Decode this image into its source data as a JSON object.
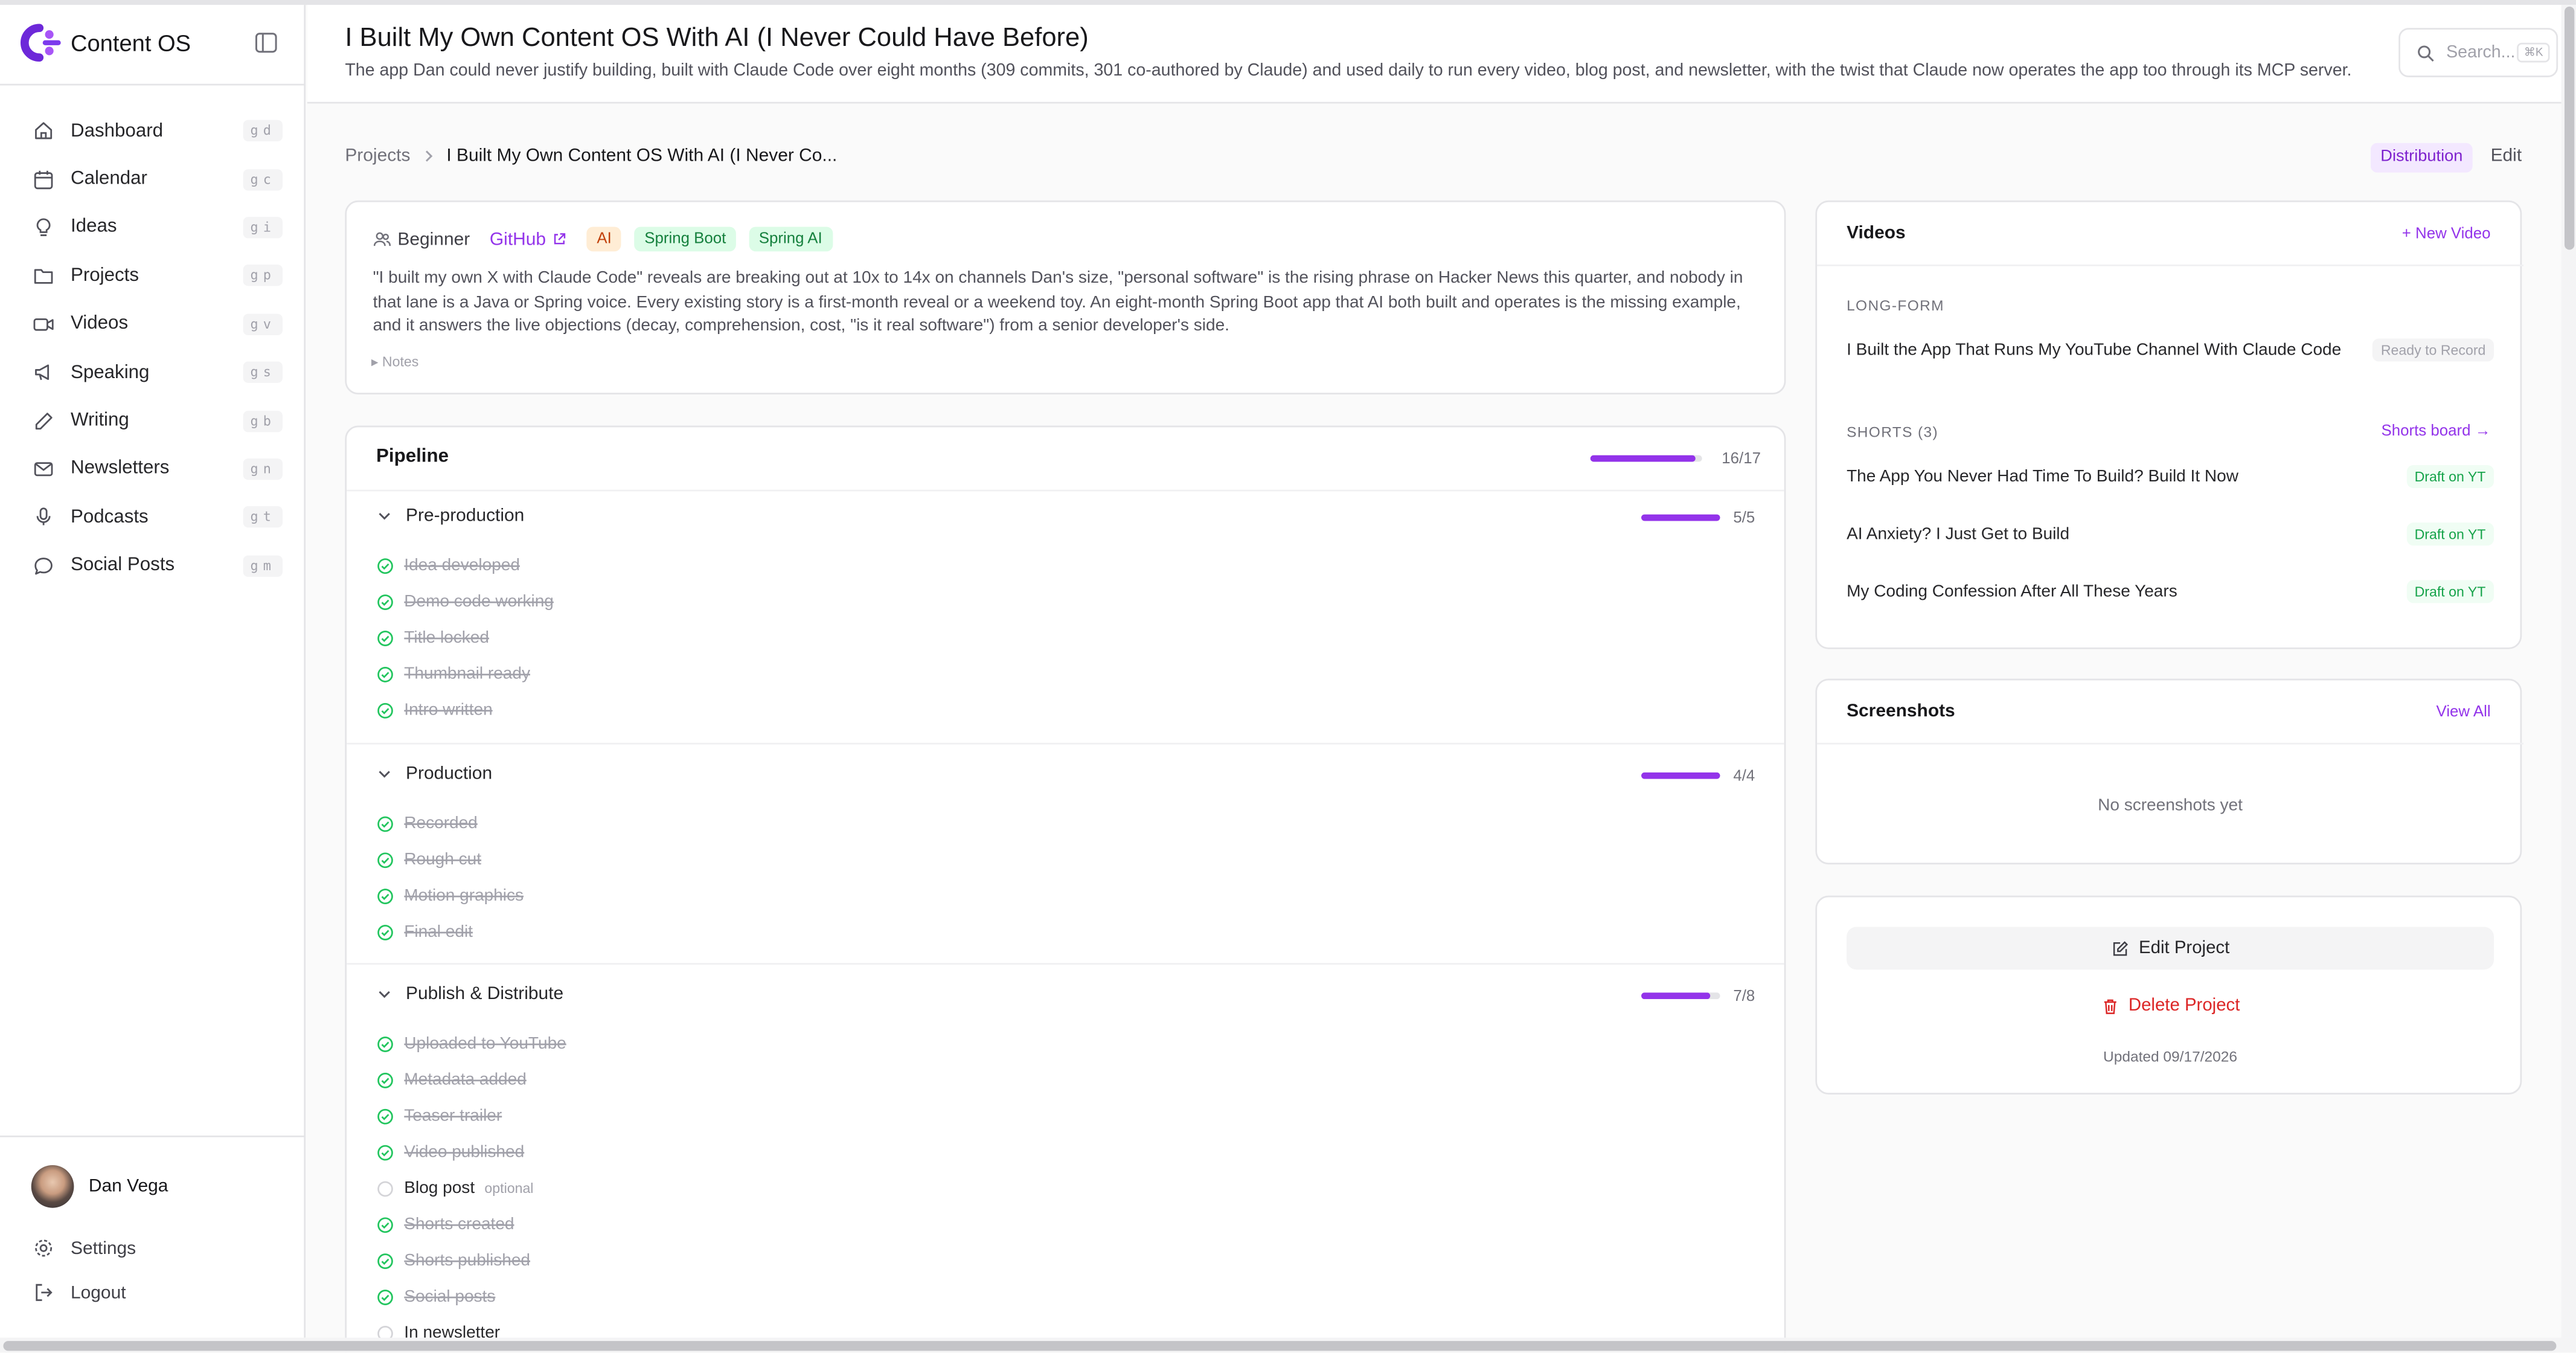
{
  "app": {
    "name": "Content OS"
  },
  "sidebar": {
    "items": [
      {
        "label": "Dashboard",
        "shortcut": "gd",
        "icon": "home-icon"
      },
      {
        "label": "Calendar",
        "shortcut": "gc",
        "icon": "calendar-icon"
      },
      {
        "label": "Ideas",
        "shortcut": "gi",
        "icon": "lightbulb-icon"
      },
      {
        "label": "Projects",
        "shortcut": "gp",
        "icon": "folder-icon"
      },
      {
        "label": "Videos",
        "shortcut": "gv",
        "icon": "video-icon"
      },
      {
        "label": "Speaking",
        "shortcut": "gs",
        "icon": "megaphone-icon"
      },
      {
        "label": "Writing",
        "shortcut": "gb",
        "icon": "pen-icon"
      },
      {
        "label": "Newsletters",
        "shortcut": "gn",
        "icon": "mail-icon"
      },
      {
        "label": "Podcasts",
        "shortcut": "gt",
        "icon": "mic-icon"
      },
      {
        "label": "Social Posts",
        "shortcut": "gm",
        "icon": "chat-icon"
      }
    ],
    "user": {
      "name": "Dan Vega"
    },
    "settings_label": "Settings",
    "logout_label": "Logout"
  },
  "header": {
    "title": "I Built My Own Content OS With AI (I Never Could Have Before)",
    "subtitle": "The app Dan could never justify building, built with Claude Code over eight months (309 commits, 301 co-authored by Claude) and used daily to run every video, blog post, and newsletter, with the twist that Claude now operates the app too through its MCP server.",
    "search_placeholder": "Search...",
    "search_shortcut": "⌘K"
  },
  "breadcrumb": {
    "root": "Projects",
    "current": "I Built My Own Content OS With AI (I Never Co..."
  },
  "tabs": {
    "distribution": "Distribution",
    "edit": "Edit"
  },
  "summary": {
    "level": "Beginner",
    "github": "GitHub",
    "tags": [
      "AI",
      "Spring Boot",
      "Spring AI"
    ],
    "text": "\"I built my own X with Claude Code\" reveals are breaking out at 10x to 14x on channels Dan's size, \"personal software\" is the rising phrase on Hacker News this quarter, and nobody in that lane is a Java or Spring voice. Every existing story is a first-month reveal or a weekend toy. An eight-month Spring Boot app that AI both built and operates is the missing example, and it answers the live objections (decay, comprehension, cost, \"is it real software\") from a senior developer's side.",
    "notes_label": "▸ Notes"
  },
  "pipeline": {
    "title": "Pipeline",
    "done": 16,
    "total": 17,
    "count": "16/17",
    "stages": [
      {
        "name": "Pre-production",
        "done": 5,
        "total": 5,
        "count": "5/5",
        "items": [
          {
            "label": "Idea developed",
            "done": true
          },
          {
            "label": "Demo code working",
            "done": true
          },
          {
            "label": "Title locked",
            "done": true
          },
          {
            "label": "Thumbnail ready",
            "done": true
          },
          {
            "label": "Intro written",
            "done": true
          }
        ]
      },
      {
        "name": "Production",
        "done": 4,
        "total": 4,
        "count": "4/4",
        "items": [
          {
            "label": "Recorded",
            "done": true
          },
          {
            "label": "Rough cut",
            "done": true
          },
          {
            "label": "Motion graphics",
            "done": true
          },
          {
            "label": "Final edit",
            "done": true
          }
        ]
      },
      {
        "name": "Publish & Distribute",
        "done": 7,
        "total": 8,
        "count": "7/8",
        "items": [
          {
            "label": "Uploaded to YouTube",
            "done": true
          },
          {
            "label": "Metadata added",
            "done": true
          },
          {
            "label": "Teaser trailer",
            "done": true
          },
          {
            "label": "Video published",
            "done": true
          },
          {
            "label": "Blog post",
            "done": false,
            "note": "optional"
          },
          {
            "label": "Shorts created",
            "done": true
          },
          {
            "label": "Shorts published",
            "done": true
          },
          {
            "label": "Social posts",
            "done": true
          },
          {
            "label": "In newsletter",
            "done": false
          }
        ]
      }
    ]
  },
  "videos": {
    "title": "Videos",
    "new_label": "+ New Video",
    "longform_label": "LONG-FORM",
    "longform": [
      {
        "title": "I Built the App That Runs My YouTube Channel With Claude Code",
        "status": "Ready to Record"
      }
    ],
    "shorts_label": "SHORTS (3)",
    "shorts_board_label": "Shorts board →",
    "shorts": [
      {
        "title": "The App You Never Had Time To Build? Build It Now",
        "status": "Draft on YT"
      },
      {
        "title": "AI Anxiety? I Just Get to Build",
        "status": "Draft on YT"
      },
      {
        "title": "My Coding Confession After All These Years",
        "status": "Draft on YT"
      }
    ]
  },
  "screenshots": {
    "title": "Screenshots",
    "view_all": "View All",
    "empty": "No screenshots yet"
  },
  "project_actions": {
    "edit": "Edit Project",
    "delete": "Delete Project",
    "updated": "Updated 09/17/2026"
  },
  "colors": {
    "accent": "#9333ea",
    "success": "#16a34a",
    "danger": "#dc2626"
  }
}
